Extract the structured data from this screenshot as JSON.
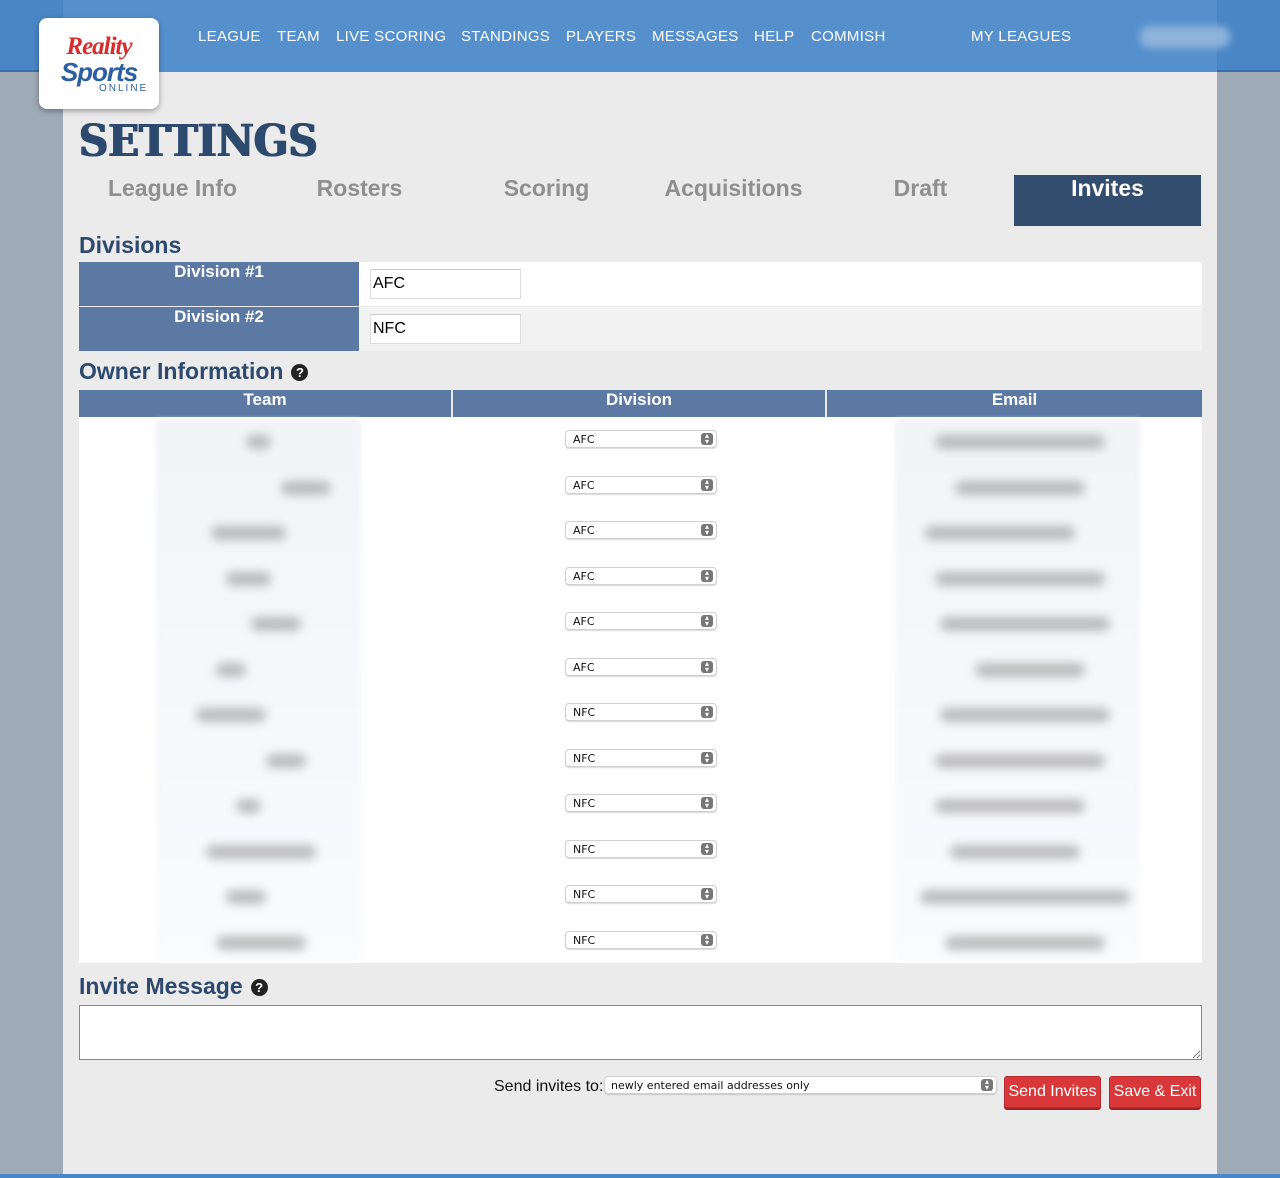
{
  "logo": {
    "line1": "Reality",
    "line2": "Sports",
    "line3": "ONLINE"
  },
  "nav": {
    "items": [
      "LEAGUE",
      "TEAM",
      "LIVE SCORING",
      "STANDINGS",
      "PLAYERS",
      "MESSAGES",
      "HELP",
      "COMMISH"
    ],
    "my_leagues": "MY LEAGUES"
  },
  "page": {
    "title": "SETTINGS"
  },
  "tabs": [
    {
      "label": "League Info",
      "active": false
    },
    {
      "label": "Rosters",
      "active": false
    },
    {
      "label": "Scoring",
      "active": false
    },
    {
      "label": "Acquisitions",
      "active": false
    },
    {
      "label": "Draft",
      "active": false
    },
    {
      "label": "Invites",
      "active": true
    }
  ],
  "divisions": {
    "title": "Divisions",
    "rows": [
      {
        "label": "Division #1",
        "value": "AFC"
      },
      {
        "label": "Division #2",
        "value": "NFC"
      }
    ]
  },
  "owners": {
    "title": "Owner Information",
    "help": "?",
    "columns": [
      "Team",
      "Division",
      "Email"
    ],
    "rows": [
      {
        "division": "AFC"
      },
      {
        "division": "AFC"
      },
      {
        "division": "AFC"
      },
      {
        "division": "AFC"
      },
      {
        "division": "AFC"
      },
      {
        "division": "AFC"
      },
      {
        "division": "NFC"
      },
      {
        "division": "NFC"
      },
      {
        "division": "NFC"
      },
      {
        "division": "NFC"
      },
      {
        "division": "NFC"
      },
      {
        "division": "NFC"
      }
    ]
  },
  "invite": {
    "title": "Invite Message",
    "help": "?",
    "message": "",
    "send_to_label": "Send invites to:",
    "send_to_value": "newly entered email addresses only",
    "send_button": "Send Invites",
    "save_button": "Save & Exit"
  },
  "colors": {
    "header": "#5590cd",
    "table_header": "#5b79a3",
    "active_tab": "#334d6e",
    "title": "#2d4a6e",
    "button": "#d9383a"
  }
}
